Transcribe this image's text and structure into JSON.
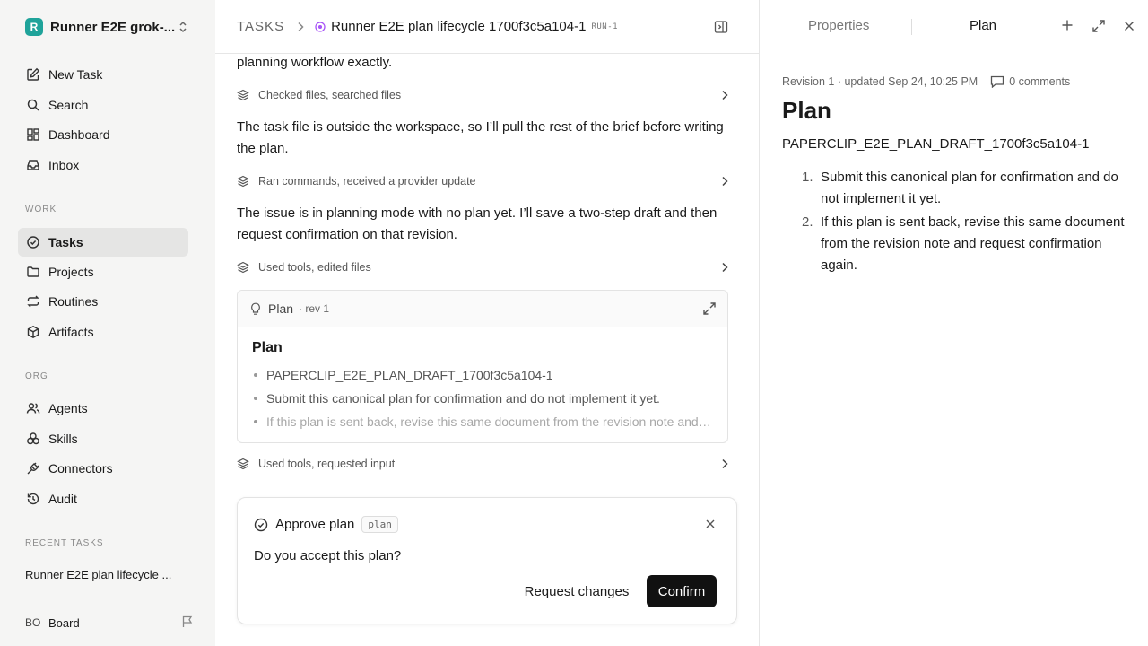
{
  "workspace": {
    "logo_letter": "R",
    "name": "Runner E2E grok-..."
  },
  "sidebar": {
    "top_items": [
      {
        "label": "New Task",
        "icon": "pencil-square-icon"
      },
      {
        "label": "Search",
        "icon": "search-icon"
      },
      {
        "label": "Dashboard",
        "icon": "dashboard-icon"
      },
      {
        "label": "Inbox",
        "icon": "inbox-icon"
      }
    ],
    "work_heading": "WORK",
    "work_items": [
      {
        "label": "Tasks",
        "icon": "check-circle-icon",
        "active": true
      },
      {
        "label": "Projects",
        "icon": "folder-icon"
      },
      {
        "label": "Routines",
        "icon": "repeat-icon"
      },
      {
        "label": "Artifacts",
        "icon": "box-icon"
      }
    ],
    "org_heading": "ORG",
    "org_items": [
      {
        "label": "Agents",
        "icon": "users-icon"
      },
      {
        "label": "Skills",
        "icon": "skills-icon"
      },
      {
        "label": "Connectors",
        "icon": "plug-icon"
      },
      {
        "label": "Audit",
        "icon": "history-icon"
      }
    ],
    "recent_heading": "RECENT TASKS",
    "recent_items": [
      "Runner E2E plan lifecycle ..."
    ],
    "footer": {
      "initials": "BO",
      "label": "Board"
    }
  },
  "header": {
    "breadcrumb_root": "TASKS",
    "task_title": "Runner E2E plan lifecycle 1700f3c5a104-1",
    "task_id": "RUN-1"
  },
  "thread": {
    "para_top_tail": "planning workflow exactly.",
    "activity_1": "Checked files, searched files",
    "para_2": "The task file is outside the workspace, so I’ll pull the rest of the brief before writing the plan.",
    "activity_2": "Ran commands, received a provider update",
    "para_3": "The issue is in planning mode with no plan yet. I’ll save a two-step draft and then request confirmation on that revision.",
    "activity_3": "Used tools, edited files",
    "plan_card": {
      "label": "Plan",
      "rev": "· rev 1",
      "heading": "Plan",
      "items": [
        "PAPERCLIP_E2E_PLAN_DRAFT_1700f3c5a104-1",
        "Submit this canonical plan for confirmation and do not implement it yet.",
        "If this plan is sent back, revise this same document from the revision note and request confirmation again."
      ]
    },
    "activity_4": "Used tools, requested input"
  },
  "approval": {
    "title": "Approve plan",
    "tag": "plan",
    "question": "Do you accept this plan?",
    "request_changes_label": "Request changes",
    "confirm_label": "Confirm"
  },
  "right_panel": {
    "tabs": [
      "Properties",
      "Plan"
    ],
    "active_tab": "Plan",
    "meta": "Revision 1 · updated Sep 24, 10:25 PM",
    "comments": "0 comments",
    "doc_title": "Plan",
    "doc_code": "PAPERCLIP_E2E_PLAN_DRAFT_1700f3c5a104-1",
    "doc_items": [
      "Submit this canonical plan for confirmation and do not implement it yet.",
      "If this plan is sent back, revise this same document from the revision note and request confirmation again."
    ],
    "doc_item_numbers": [
      "1.",
      "2."
    ]
  },
  "colors": {
    "accent_status": "#a855f7",
    "logo_bg": "#1fa39a",
    "confirm_bg": "#111111"
  }
}
